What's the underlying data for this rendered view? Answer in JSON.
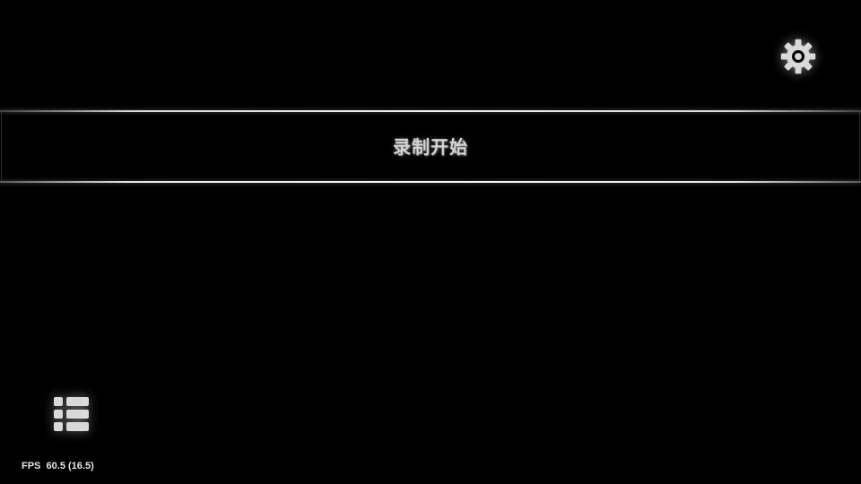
{
  "settings": {
    "icon": "gear-icon"
  },
  "banner": {
    "text": "录制开始"
  },
  "list_menu": {
    "icon": "list-icon"
  },
  "fps": {
    "label": "FPS",
    "value": "60.5 (16.5)"
  },
  "colors": {
    "background": "#000000",
    "icon": "#d9d9d9",
    "banner_text": "#d4d4d4",
    "fps_text": "#e6e6e6"
  }
}
